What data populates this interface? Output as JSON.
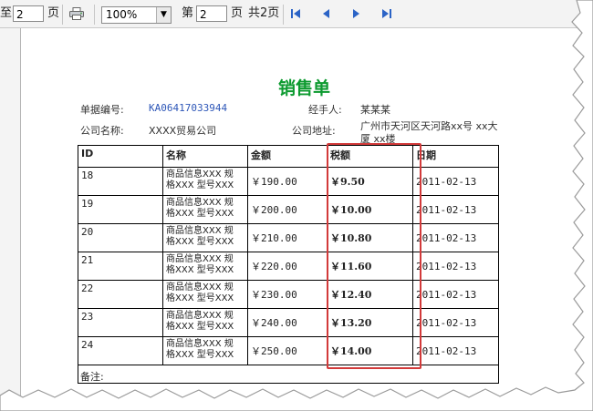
{
  "toolbar": {
    "page_prefix": "至",
    "page_value": "2",
    "page_suffix": "页",
    "zoom": "100%",
    "goto_prefix": "第",
    "goto_value": "2",
    "goto_suffix": "页",
    "total_pages": "共2页"
  },
  "report": {
    "title": "销售单",
    "order_no_label": "单据编号:",
    "order_no": "KA06417033944",
    "handler_label": "经手人:",
    "handler": "某某某",
    "company_label": "公司名称:",
    "company": "XXXX贸易公司",
    "address_label": "公司地址:",
    "address_line1": "广州市天河区天河路xx号 xx大",
    "address_line2": "厦 xx楼",
    "columns": [
      "ID",
      "名称",
      "金额",
      "税额",
      "日期"
    ],
    "rows": [
      {
        "id": "18",
        "name1": "商品信息XXX 规",
        "name2": "格XXX 型号XXX",
        "amount": "￥190.00",
        "tax": "￥9.50",
        "date": "2011-02-13",
        "tax_color": "blue"
      },
      {
        "id": "19",
        "name1": "商品信息XXX 规",
        "name2": "格XXX 型号XXX",
        "amount": "￥200.00",
        "tax": "￥10.00",
        "date": "2011-02-13",
        "tax_color": "blue"
      },
      {
        "id": "20",
        "name1": "商品信息XXX 规",
        "name2": "格XXX 型号XXX",
        "amount": "￥210.00",
        "tax": "￥10.80",
        "date": "2011-02-13",
        "tax_color": "red"
      },
      {
        "id": "21",
        "name1": "商品信息XXX 规",
        "name2": "格XXX 型号XXX",
        "amount": "￥220.00",
        "tax": "￥11.60",
        "date": "2011-02-13",
        "tax_color": "red"
      },
      {
        "id": "22",
        "name1": "商品信息XXX 规",
        "name2": "格XXX 型号XXX",
        "amount": "￥230.00",
        "tax": "￥12.40",
        "date": "2011-02-13",
        "tax_color": "red"
      },
      {
        "id": "23",
        "name1": "商品信息XXX 规",
        "name2": "格XXX 型号XXX",
        "amount": "￥240.00",
        "tax": "￥13.20",
        "date": "2011-02-13",
        "tax_color": "red"
      },
      {
        "id": "24",
        "name1": "商品信息XXX 规",
        "name2": "格XXX 型号XXX",
        "amount": "￥250.00",
        "tax": "￥14.00",
        "date": "2011-02-13",
        "tax_color": "red"
      }
    ],
    "note_label": "备注:"
  },
  "icons": {
    "printer": "printer-icon",
    "first": "first-page-icon",
    "prev": "prev-page-icon",
    "next": "next-page-icon",
    "last": "last-page-icon"
  },
  "colors": {
    "title": "#0c9a2f",
    "order_no": "#2e57b8",
    "tax_blue": "#1d2fa3",
    "tax_red": "#c61b1b",
    "highlight_box": "#d23a3a",
    "nav_icons": "#2b63c6"
  }
}
